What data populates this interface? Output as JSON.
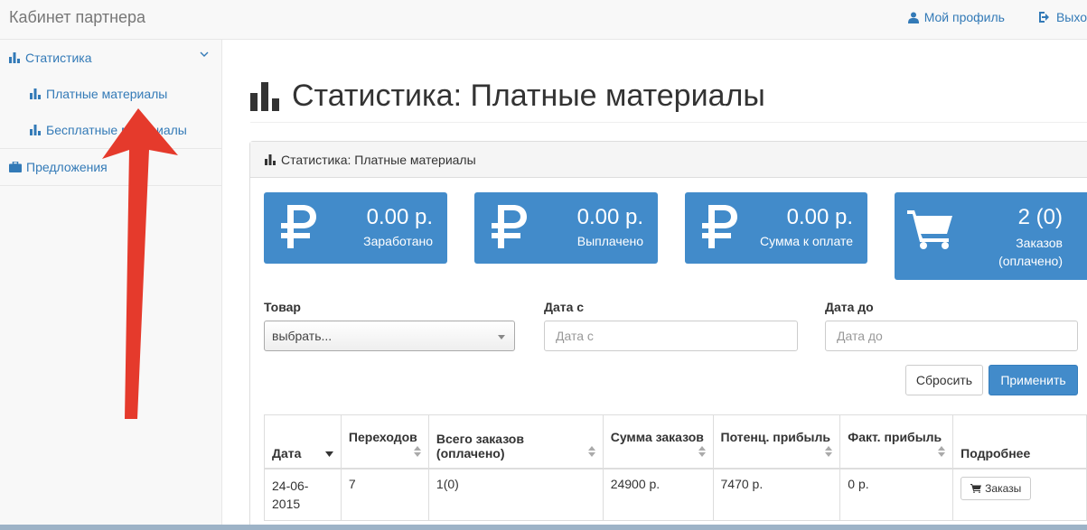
{
  "header": {
    "brand": "Кабинет партнера",
    "profile_label": "Мой профиль",
    "logout_label": "Выхо"
  },
  "sidebar": {
    "items": [
      {
        "label": "Статистика"
      },
      {
        "label": "Платные материалы"
      },
      {
        "label": "Бесплатные материалы"
      },
      {
        "label": "Предложения"
      }
    ]
  },
  "page": {
    "title": "Статистика: Платные материалы",
    "panel_title": "Статистика: Платные материалы"
  },
  "stats": [
    {
      "value": "0.00 р.",
      "label": "Заработано",
      "icon": "ruble-icon"
    },
    {
      "value": "0.00 р.",
      "label": "Выплачено",
      "icon": "ruble-icon"
    },
    {
      "value": "0.00 р.",
      "label": "Сумма к оплате",
      "icon": "ruble-icon"
    },
    {
      "value": "2 (0)",
      "label": "Заказов (оплачено)",
      "icon": "cart-icon"
    }
  ],
  "filters": {
    "product_label": "Товар",
    "product_value": "выбрать...",
    "date_from_label": "Дата с",
    "date_from_placeholder": "Дата с",
    "date_to_label": "Дата до",
    "date_to_placeholder": "Дата до",
    "reset_label": "Сбросить",
    "apply_label": "Применить"
  },
  "table": {
    "headers": [
      "Дата",
      "Переходов",
      "Всего заказов (оплачено)",
      "Сумма заказов",
      "Потенц. прибыль",
      "Факт. прибыль",
      "Подробнее"
    ],
    "rows": [
      {
        "date": "24-06-2015",
        "visits": "7",
        "orders": "1(0)",
        "sum": "24900 р.",
        "potential": "7470 р.",
        "actual": "0 р.",
        "details": "Заказы"
      }
    ]
  },
  "colors": {
    "accent": "#428bca",
    "link": "#337ab7",
    "annotation_arrow": "#e53a2c"
  }
}
